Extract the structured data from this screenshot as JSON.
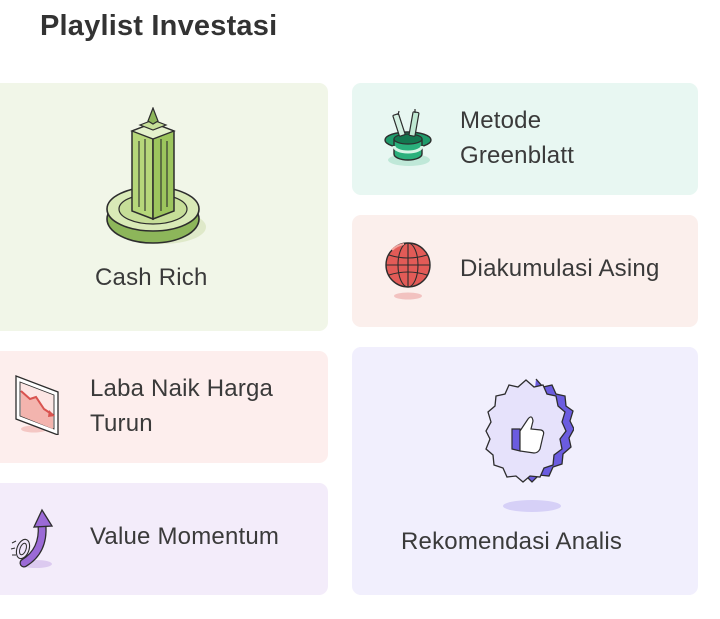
{
  "header": {
    "title": "Playlist Investasi"
  },
  "cards": [
    {
      "label": "Cash Rich",
      "icon": "skyscraper-icon",
      "bg": "#f1f6e8"
    },
    {
      "label": "Metode\nGreenblatt",
      "icon": "top-hat-money-icon",
      "bg": "#e8f7f2"
    },
    {
      "label": "Diakumulasi Asing",
      "icon": "globe-icon",
      "bg": "#fbefec"
    },
    {
      "label": "Laba Naik Harga\nTurun",
      "icon": "declining-chart-icon",
      "bg": "#fdeeed"
    },
    {
      "label": "Rekomendasi Analis",
      "icon": "thumbs-up-badge-icon",
      "bg": "#f1effd"
    },
    {
      "label": "Value Momentum",
      "icon": "rising-arrow-icon",
      "bg": "#f3ecfa"
    }
  ]
}
